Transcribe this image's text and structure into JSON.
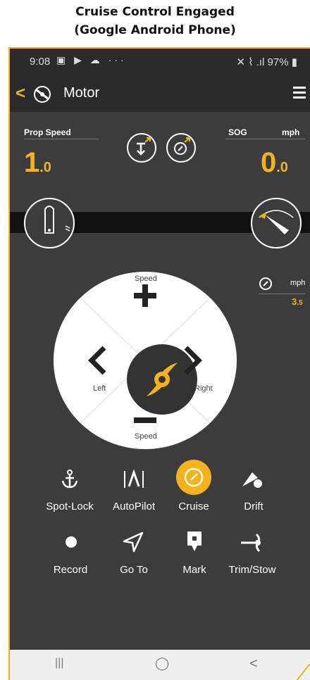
{
  "caption": {
    "line1": "Cruise Control Engaged",
    "line2": "(Google Android Phone)"
  },
  "statusbar": {
    "time": "9:08",
    "notif_icons": "▣ ▶ ☁ ···",
    "right": "✕ ⌇ .ıl 97% ▮"
  },
  "appbar": {
    "back": "<",
    "title": "Motor"
  },
  "readouts": {
    "prop_label": "Prop Speed",
    "prop_int": "1",
    "prop_dec": ".0",
    "sog_label": "SOG",
    "sog_unit": "mph",
    "sog_int": "0",
    "sog_dec": ".0"
  },
  "cruise_speed": {
    "unit": "mph",
    "value_int": "3",
    "value_dec": ".5"
  },
  "wheel": {
    "top_label": "Speed",
    "bottom_label": "Speed",
    "left_label": "Left",
    "right_label": "Right"
  },
  "actions": {
    "row1": [
      "Spot-Lock",
      "AutoPilot",
      "Cruise",
      "Drift"
    ],
    "row2": [
      "Record",
      "Go To",
      "Mark",
      "Trim/Stow"
    ]
  },
  "navbar": {
    "recent": "|||",
    "home": "◯",
    "back": "<"
  },
  "colors": {
    "accent": "#f4b21c",
    "background": "#3c3c3c",
    "bar": "#2b2b2b"
  }
}
